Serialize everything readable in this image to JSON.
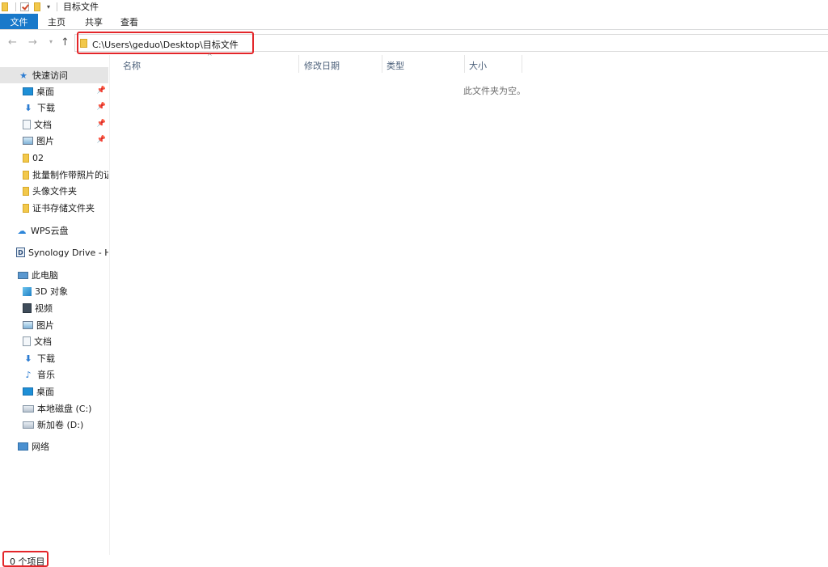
{
  "window": {
    "title": "目标文件"
  },
  "ribbon": {
    "tabs": [
      "文件",
      "主页",
      "共享",
      "查看"
    ]
  },
  "navbar": {
    "back_icon": "arrow-left-icon",
    "forward_icon": "arrow-right-icon",
    "recent_icon": "chevron-down-icon",
    "up_icon": "arrow-up-icon",
    "address": "C:\\Users\\geduo\\Desktop\\目标文件"
  },
  "sidebar": {
    "quick_access": {
      "label": "快速访问",
      "icon": "star-icon"
    },
    "quick_items": [
      {
        "label": "桌面",
        "icon": "desktop-icon",
        "pinned": true
      },
      {
        "label": "下载",
        "icon": "download-icon",
        "pinned": true
      },
      {
        "label": "文档",
        "icon": "document-icon",
        "pinned": true
      },
      {
        "label": "图片",
        "icon": "pictures-icon",
        "pinned": true
      },
      {
        "label": "02",
        "icon": "folder-icon",
        "pinned": false
      },
      {
        "label": "批量制作带照片的证",
        "icon": "folder-icon",
        "pinned": false
      },
      {
        "label": "头像文件夹",
        "icon": "folder-icon",
        "pinned": false
      },
      {
        "label": "证书存储文件夹",
        "icon": "folder-icon",
        "pinned": false
      }
    ],
    "wps": {
      "label": "WPS云盘",
      "icon": "cloud-icon"
    },
    "synology": {
      "label": "Synology Drive - HO",
      "icon": "synology-drive-icon"
    },
    "this_pc": {
      "label": "此电脑",
      "icon": "computer-icon"
    },
    "pc_items": [
      {
        "label": "3D 对象",
        "icon": "3d-objects-icon"
      },
      {
        "label": "视频",
        "icon": "video-icon"
      },
      {
        "label": "图片",
        "icon": "pictures-icon"
      },
      {
        "label": "文档",
        "icon": "document-icon"
      },
      {
        "label": "下载",
        "icon": "download-icon"
      },
      {
        "label": "音乐",
        "icon": "music-icon"
      },
      {
        "label": "桌面",
        "icon": "desktop-icon"
      },
      {
        "label": "本地磁盘 (C:)",
        "icon": "windows-drive-icon"
      },
      {
        "label": "新加卷 (D:)",
        "icon": "drive-icon"
      }
    ],
    "network": {
      "label": "网络",
      "icon": "network-icon"
    }
  },
  "content": {
    "columns": [
      "名称",
      "修改日期",
      "类型",
      "大小"
    ],
    "empty_message": "此文件夹为空。"
  },
  "status": {
    "item_count": "0 个项目"
  },
  "colors": {
    "accent": "#1979ca",
    "highlight_box": "#e3262a"
  }
}
